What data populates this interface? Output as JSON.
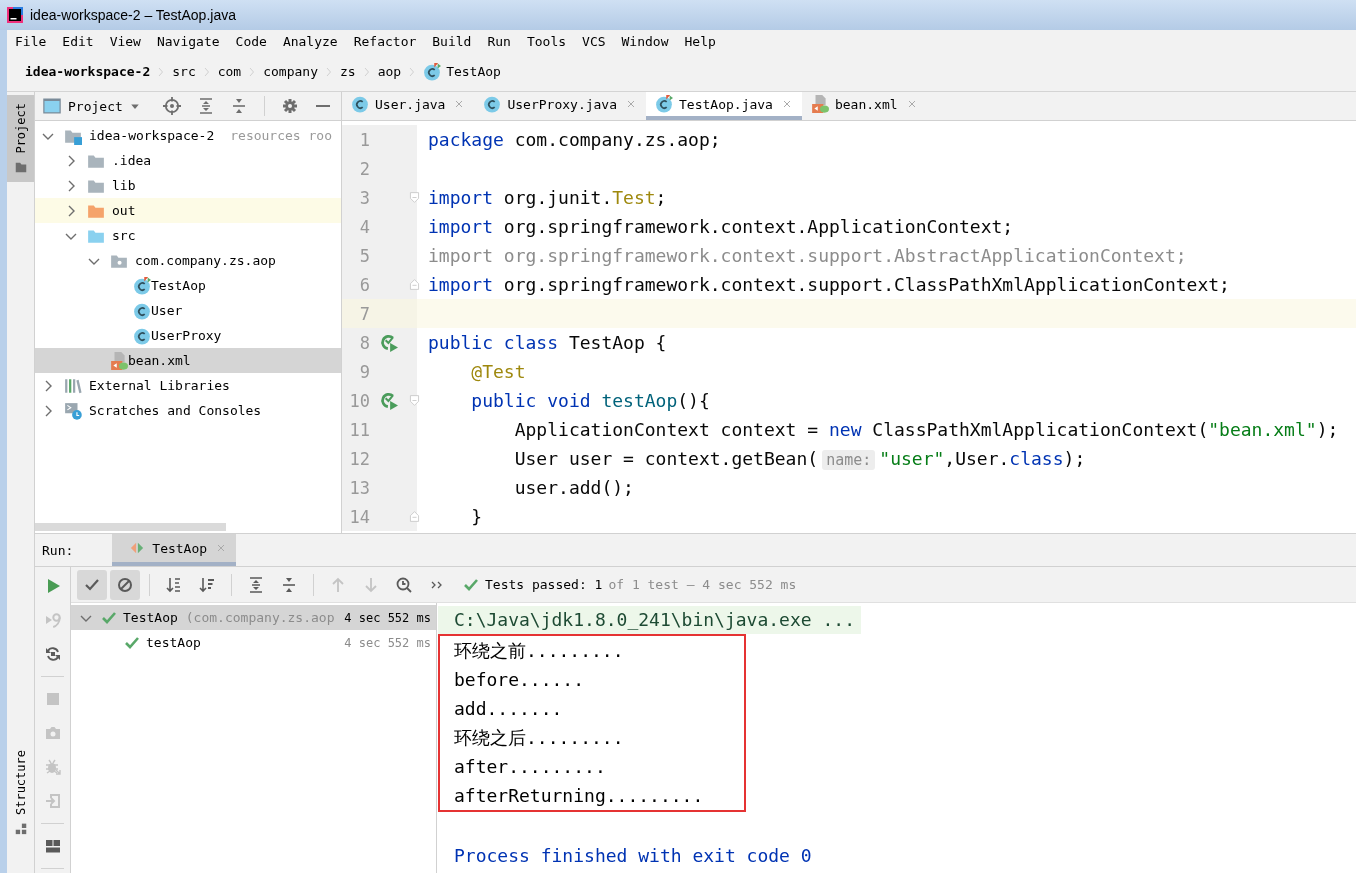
{
  "window": {
    "title": "idea-workspace-2 – TestAop.java"
  },
  "menu": [
    "File",
    "Edit",
    "View",
    "Navigate",
    "Code",
    "Analyze",
    "Refactor",
    "Build",
    "Run",
    "Tools",
    "VCS",
    "Window",
    "Help"
  ],
  "breadcrumb": [
    {
      "label": "idea-workspace-2",
      "kind": "project"
    },
    {
      "label": "src",
      "kind": "folder"
    },
    {
      "label": "com",
      "kind": "folder"
    },
    {
      "label": "company",
      "kind": "folder"
    },
    {
      "label": "zs",
      "kind": "folder"
    },
    {
      "label": "aop",
      "kind": "folder"
    },
    {
      "label": "TestAop",
      "kind": "test-class"
    }
  ],
  "tool_strip": {
    "top_tab": {
      "label": "Project",
      "selected": true
    },
    "bottom_tab": {
      "label": "Structure",
      "selected": false
    }
  },
  "project_panel": {
    "title": "Project",
    "tree": [
      {
        "label": "idea-workspace-2",
        "note": "resources roo",
        "kind": "module",
        "expanded": true,
        "selected": false,
        "highlighted": false,
        "children": [
          {
            "label": ".idea",
            "kind": "folder",
            "expanded": false,
            "selected": false,
            "highlighted": false
          },
          {
            "label": "lib",
            "kind": "folder",
            "expanded": false,
            "selected": false,
            "highlighted": false
          },
          {
            "label": "out",
            "kind": "excluded-folder",
            "expanded": false,
            "selected": false,
            "highlighted": true
          },
          {
            "label": "src",
            "kind": "source-folder",
            "expanded": true,
            "selected": false,
            "highlighted": false,
            "children": [
              {
                "label": "com.company.zs.aop",
                "kind": "package",
                "expanded": true,
                "selected": false,
                "highlighted": false,
                "children": [
                  {
                    "label": "TestAop",
                    "kind": "test-class",
                    "selected": false,
                    "highlighted": false
                  },
                  {
                    "label": "User",
                    "kind": "class",
                    "selected": false,
                    "highlighted": false
                  },
                  {
                    "label": "UserProxy",
                    "kind": "class",
                    "selected": false,
                    "highlighted": false
                  }
                ]
              },
              {
                "label": "bean.xml",
                "kind": "xml",
                "selected": true,
                "highlighted": false
              }
            ]
          }
        ]
      },
      {
        "label": "External Libraries",
        "kind": "libraries",
        "expanded": false,
        "selected": false,
        "highlighted": false
      },
      {
        "label": "Scratches and Consoles",
        "kind": "scratches",
        "expanded": false,
        "selected": false,
        "highlighted": false
      }
    ]
  },
  "editor": {
    "tabs": [
      {
        "label": "User.java",
        "kind": "class",
        "selected": false
      },
      {
        "label": "UserProxy.java",
        "kind": "class",
        "selected": false
      },
      {
        "label": "TestAop.java",
        "kind": "test-class",
        "selected": true
      },
      {
        "label": "bean.xml",
        "kind": "xml",
        "selected": false
      }
    ],
    "lines": [
      {
        "number": "1",
        "current": false,
        "run_marker": false,
        "fold_start": false,
        "fold_end": false,
        "tokens": [
          {
            "kind": "keyword",
            "text": "package"
          },
          {
            "kind": "plain",
            "text": " com.company.zs.aop;"
          }
        ]
      },
      {
        "number": "2",
        "current": false,
        "run_marker": false,
        "fold_start": false,
        "fold_end": false
      },
      {
        "number": "3",
        "current": false,
        "run_marker": false,
        "fold_start": true,
        "fold_end": false,
        "tokens": [
          {
            "kind": "keyword",
            "text": "import"
          },
          {
            "kind": "plain",
            "text": " org.junit."
          },
          {
            "kind": "annotation",
            "text": "Test"
          },
          {
            "kind": "plain",
            "text": ";"
          }
        ]
      },
      {
        "number": "4",
        "current": false,
        "run_marker": false,
        "fold_start": false,
        "fold_end": false,
        "tokens": [
          {
            "kind": "keyword",
            "text": "import"
          },
          {
            "kind": "plain",
            "text": " org.springframework.context.ApplicationContext;"
          }
        ]
      },
      {
        "number": "5",
        "current": false,
        "run_marker": false,
        "fold_start": false,
        "fold_end": false,
        "tokens": [
          {
            "kind": "unused",
            "text": "import org.springframework.context.support.AbstractApplicationContext;"
          }
        ]
      },
      {
        "number": "6",
        "current": false,
        "run_marker": false,
        "fold_start": false,
        "fold_end": true,
        "tokens": [
          {
            "kind": "keyword",
            "text": "import"
          },
          {
            "kind": "plain",
            "text": " org.springframework.context.support.ClassPathXmlApplicationContext;"
          }
        ]
      },
      {
        "number": "7",
        "current": true,
        "run_marker": false,
        "fold_start": false,
        "fold_end": false
      },
      {
        "number": "8",
        "current": false,
        "run_marker": true,
        "fold_start": false,
        "fold_end": false,
        "tokens": [
          {
            "kind": "keyword",
            "text": "public class"
          },
          {
            "kind": "plain",
            "text": " TestAop {"
          }
        ]
      },
      {
        "number": "9",
        "current": false,
        "run_marker": false,
        "fold_start": false,
        "fold_end": false,
        "tokens": [
          {
            "kind": "annotation",
            "text": "    @Test"
          }
        ]
      },
      {
        "number": "10",
        "current": false,
        "run_marker": true,
        "fold_start": true,
        "fold_end": false,
        "tokens": [
          {
            "kind": "keyword",
            "text": "    public void"
          },
          {
            "kind": "method",
            "text": " testAop"
          },
          {
            "kind": "plain",
            "text": "(){"
          }
        ]
      },
      {
        "number": "11",
        "current": false,
        "run_marker": false,
        "fold_start": false,
        "fold_end": false,
        "tokens": [
          {
            "kind": "plain",
            "text": "        ApplicationContext context = "
          },
          {
            "kind": "keyword",
            "text": "new"
          },
          {
            "kind": "plain",
            "text": " ClassPathXmlApplicationContext("
          },
          {
            "kind": "string",
            "text": "\"bean.xml\""
          },
          {
            "kind": "plain",
            "text": ");"
          }
        ]
      },
      {
        "number": "12",
        "current": false,
        "run_marker": false,
        "fold_start": false,
        "fold_end": false,
        "tokens": [
          {
            "kind": "plain",
            "text": "        User user = context.getBean("
          },
          {
            "kind": "hint",
            "text": "name:"
          },
          {
            "kind": "string",
            "text": "\"user\""
          },
          {
            "kind": "plain",
            "text": ",User."
          },
          {
            "kind": "keyword",
            "text": "class"
          },
          {
            "kind": "plain",
            "text": ");"
          }
        ]
      },
      {
        "number": "13",
        "current": false,
        "run_marker": false,
        "fold_start": false,
        "fold_end": false,
        "tokens": [
          {
            "kind": "plain",
            "text": "        user.add();"
          }
        ]
      },
      {
        "number": "14",
        "current": false,
        "run_marker": false,
        "fold_start": false,
        "fold_end": true,
        "tokens": [
          {
            "kind": "plain",
            "text": "    }"
          }
        ]
      }
    ]
  },
  "run_panel": {
    "label": "Run:",
    "tab": {
      "label": "TestAop",
      "selected": true
    },
    "side_tools": [
      {
        "kind": "run",
        "disabled": false
      },
      {
        "kind": "rerun-failed",
        "disabled": true
      },
      {
        "kind": "rerun-auto",
        "disabled": false
      },
      {
        "kind": "separator"
      },
      {
        "kind": "stop",
        "disabled": true
      },
      {
        "kind": "camera",
        "disabled": true
      },
      {
        "kind": "bug",
        "disabled": true
      },
      {
        "kind": "import",
        "disabled": true
      },
      {
        "kind": "separator"
      },
      {
        "kind": "layout",
        "disabled": false
      },
      {
        "kind": "separator"
      }
    ],
    "toolbar": [
      {
        "kind": "show-passed",
        "pressed": true,
        "disabled": false
      },
      {
        "kind": "show-ignored",
        "pressed": true,
        "disabled": false
      },
      {
        "kind": "separator"
      },
      {
        "kind": "sort-alpha",
        "pressed": false,
        "disabled": false
      },
      {
        "kind": "sort-duration",
        "pressed": false,
        "disabled": false
      },
      {
        "kind": "separator"
      },
      {
        "kind": "expand",
        "pressed": false,
        "disabled": false
      },
      {
        "kind": "collapse",
        "pressed": false,
        "disabled": false
      },
      {
        "kind": "separator"
      },
      {
        "kind": "up",
        "pressed": false,
        "disabled": true
      },
      {
        "kind": "down",
        "pressed": false,
        "disabled": true
      },
      {
        "kind": "history",
        "pressed": false,
        "disabled": false
      },
      {
        "kind": "more",
        "pressed": false,
        "disabled": false
      }
    ],
    "status": {
      "summary": "Tests passed: 1",
      "detail": "of 1 test – 4 sec 552 ms"
    },
    "tests": [
      {
        "label": "TestAop",
        "detail": "(com.company.zs.aop",
        "time": "4 sec 552 ms",
        "passed": true,
        "expanded": true,
        "selected": true,
        "children": [
          {
            "label": "testAop",
            "time": "4 sec 552 ms",
            "passed": true,
            "selected": false
          }
        ]
      }
    ],
    "console": {
      "command": "C:\\Java\\jdk1.8.0_241\\bin\\java.exe ...",
      "output": [
        "环绕之前.........",
        "before......",
        "add.......",
        "环绕之后.........",
        "after.........",
        "afterReturning........."
      ],
      "exit": "Process finished with exit code 0"
    }
  }
}
